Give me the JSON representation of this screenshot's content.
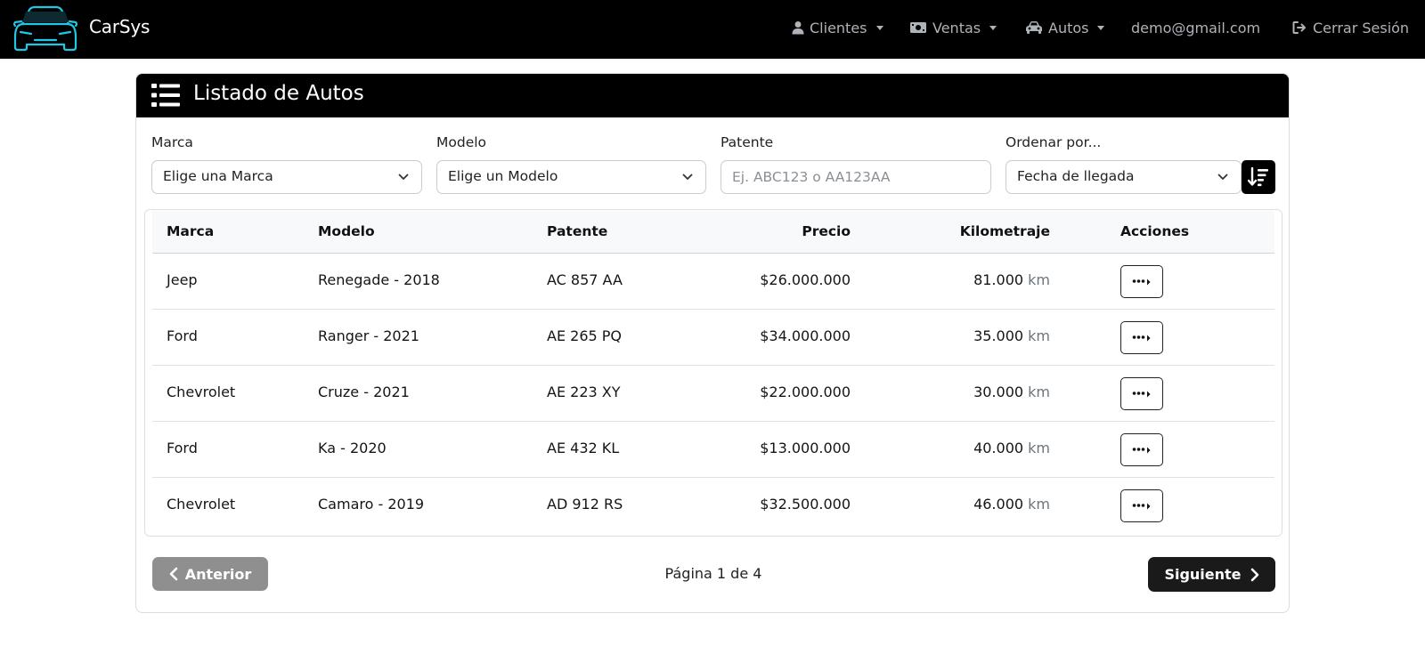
{
  "navbar": {
    "brand": "CarSys",
    "items": [
      {
        "label": "Clientes",
        "icon": "user-icon"
      },
      {
        "label": "Ventas",
        "icon": "money-icon"
      },
      {
        "label": "Autos",
        "icon": "car-icon"
      }
    ],
    "user_email": "demo@gmail.com",
    "logout_label": "Cerrar Sesión"
  },
  "card": {
    "title": "Listado de Autos"
  },
  "filters": {
    "marca_label": "Marca",
    "marca_value": "Elige una Marca",
    "modelo_label": "Modelo",
    "modelo_value": "Elige un Modelo",
    "patente_label": "Patente",
    "patente_placeholder": "Ej. ABC123 o AA123AA",
    "orden_label": "Ordenar por...",
    "orden_value": "Fecha de llegada"
  },
  "table": {
    "headers": [
      "Marca",
      "Modelo",
      "Patente",
      "Precio",
      "Kilometraje",
      "Acciones"
    ],
    "km_unit": "km",
    "rows": [
      {
        "marca": "Jeep",
        "modelo": "Renegade - 2018",
        "patente": "AC 857 AA",
        "precio": "$26.000.000",
        "km": "81.000"
      },
      {
        "marca": "Ford",
        "modelo": "Ranger - 2021",
        "patente": "AE 265 PQ",
        "precio": "$34.000.000",
        "km": "35.000"
      },
      {
        "marca": "Chevrolet",
        "modelo": "Cruze - 2021",
        "patente": "AE 223 XY",
        "precio": "$22.000.000",
        "km": "30.000"
      },
      {
        "marca": "Ford",
        "modelo": "Ka - 2020",
        "patente": "AE 432 KL",
        "precio": "$13.000.000",
        "km": "40.000"
      },
      {
        "marca": "Chevrolet",
        "modelo": "Camaro - 2019",
        "patente": "AD 912 RS",
        "precio": "$32.500.000",
        "km": "46.000"
      }
    ]
  },
  "pagination": {
    "prev_label": "Anterior",
    "page_info": "Página 1 de 4",
    "next_label": "Siguiente"
  },
  "colors": {
    "navbar_bg": "#000000",
    "logo_accent": "#1ec8e6",
    "prev_disabled": "#8f8f8f",
    "next_bg": "#1a1a1a"
  }
}
